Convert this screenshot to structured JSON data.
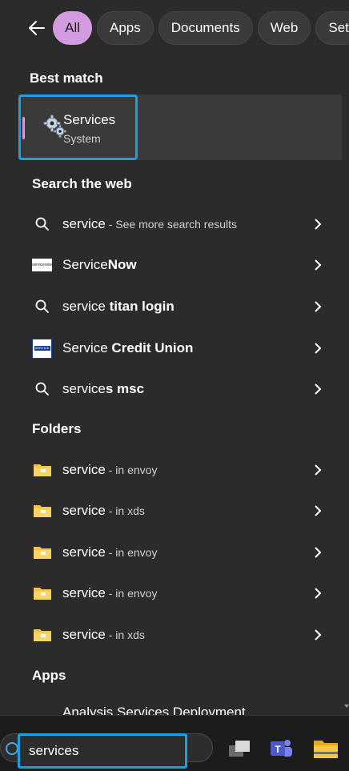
{
  "filters": {
    "back_label": "Back",
    "chips": [
      "All",
      "Apps",
      "Documents",
      "Web",
      "Set"
    ]
  },
  "best_match": {
    "header": "Best match",
    "title": "Services",
    "subtitle": "System"
  },
  "web": {
    "header": "Search the web",
    "items": [
      {
        "icon": "search-icon",
        "text": "service",
        "bold": "",
        "muted": " - See more search results"
      },
      {
        "icon": "servicenow-logo",
        "text": "Service",
        "bold": "Now",
        "muted": ""
      },
      {
        "icon": "search-icon",
        "text": "service ",
        "bold": "titan login",
        "muted": ""
      },
      {
        "icon": "service-credit-union-logo",
        "text": "Service ",
        "bold": "Credit Union",
        "muted": ""
      },
      {
        "icon": "search-icon",
        "text": "service",
        "bold": "s msc",
        "muted": ""
      }
    ]
  },
  "folders": {
    "header": "Folders",
    "items": [
      {
        "name": "service",
        "location": " - in envoy"
      },
      {
        "name": "service",
        "location": " - in xds"
      },
      {
        "name": "service",
        "location": " - in envoy"
      },
      {
        "name": "service",
        "location": " - in envoy"
      },
      {
        "name": "service",
        "location": " - in xds"
      }
    ]
  },
  "apps": {
    "header": "Apps",
    "peek_item": "Analysis Services Deployment"
  },
  "taskbar": {
    "search_value": "services",
    "apps": [
      "task-view-icon",
      "teams-icon",
      "file-explorer-icon"
    ]
  },
  "colors": {
    "accent": "#d39be0",
    "focus": "#1ba1e2",
    "folder": "#f2c443",
    "panel": "#2b2b2b"
  }
}
